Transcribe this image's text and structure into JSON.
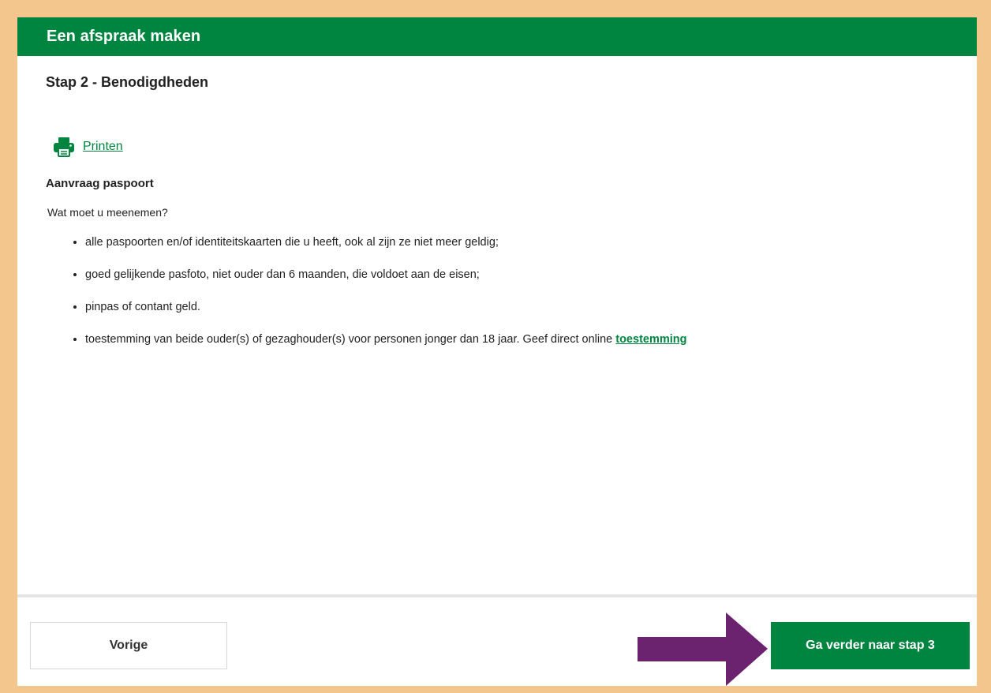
{
  "header": {
    "title": "Een afspraak maken"
  },
  "step": {
    "title": "Stap 2 - Benodigdheden"
  },
  "print": {
    "label": "Printen",
    "icon": "printer-icon"
  },
  "section": {
    "title": "Aanvraag paspoort",
    "question": "Wat moet u meenemen?",
    "items": [
      {
        "text": "alle paspoorten en/of identiteitskaarten die u heeft, ook al zijn ze niet meer geldig;"
      },
      {
        "text": "goed gelijkende pasfoto, niet ouder dan 6 maanden, die voldoet aan de eisen;"
      },
      {
        "text": "pinpas of contant geld."
      },
      {
        "text": "toestemming van beide ouder(s) of gezaghouder(s) voor personen jonger dan 18 jaar. Geef direct online ",
        "link": "toestemming"
      }
    ]
  },
  "footer": {
    "prev_label": "Vorige",
    "next_label": "Ga verder naar stap 3",
    "arrow_icon": "arrow-right-icon"
  },
  "colors": {
    "brand_green": "#008540",
    "frame_border": "#f3c68d",
    "arrow_purple": "#6b2370"
  }
}
